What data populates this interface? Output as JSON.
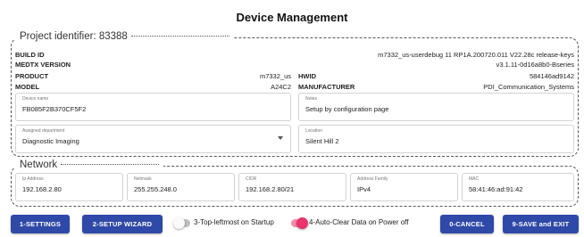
{
  "header": {
    "title": "Device Management"
  },
  "project": {
    "legend": "Project identifier: 83388",
    "build_id": {
      "key": "BUILD ID",
      "value": "m7332_us-userdebug 11 RP1A.200720.011 V22.28c release-keys"
    },
    "medtx_version": {
      "key": "MEDTX VERSION",
      "value": "v3.1.11-0d16a8b0-Bseries"
    },
    "product": {
      "key": "PRODUCT",
      "value": "m7332_us"
    },
    "model": {
      "key": "MODEL",
      "value": "A24C2"
    },
    "hwid": {
      "key": "HWID",
      "value": "584146ad9142"
    },
    "manufacturer": {
      "key": "MANUFACTURER",
      "value": "PDI_Communication_Systems"
    },
    "device_name": {
      "label": "Device name",
      "value": "FB085F2B370CF5F2"
    },
    "notes": {
      "label": "Notes",
      "value": "Setup by configuration page"
    },
    "department": {
      "label": "Assigned department",
      "value": "Diagnostic Imaging"
    },
    "location": {
      "label": "Location",
      "value": "Silent Hill 2"
    }
  },
  "network": {
    "legend": "Network",
    "ip": {
      "label": "Ip Address",
      "value": "192.168.2.80"
    },
    "netmask": {
      "label": "Netmask",
      "value": "255.255.248.0"
    },
    "cidr": {
      "label": "CIDR",
      "value": "192.168.2.80/21"
    },
    "family": {
      "label": "Address Family",
      "value": "IPv4"
    },
    "mac": {
      "label": "MAC",
      "value": "58:41:46:ad:91:42"
    }
  },
  "footer": {
    "settings_label": "1-SETTINGS",
    "wizard_label": "2-SETUP WIZARD",
    "topmost_label": "3-Top-leftmost on Startup",
    "topmost_on": false,
    "autoclear_label": "4-Auto-Clear Data on Power off",
    "autoclear_on": true,
    "cancel_label": "0-CANCEL",
    "save_label": "9-SAVE and EXIT"
  },
  "colors": {
    "button": "#2f49a8",
    "toggle_on": "#e8346a",
    "toggle_off": "#bdbdbd"
  }
}
